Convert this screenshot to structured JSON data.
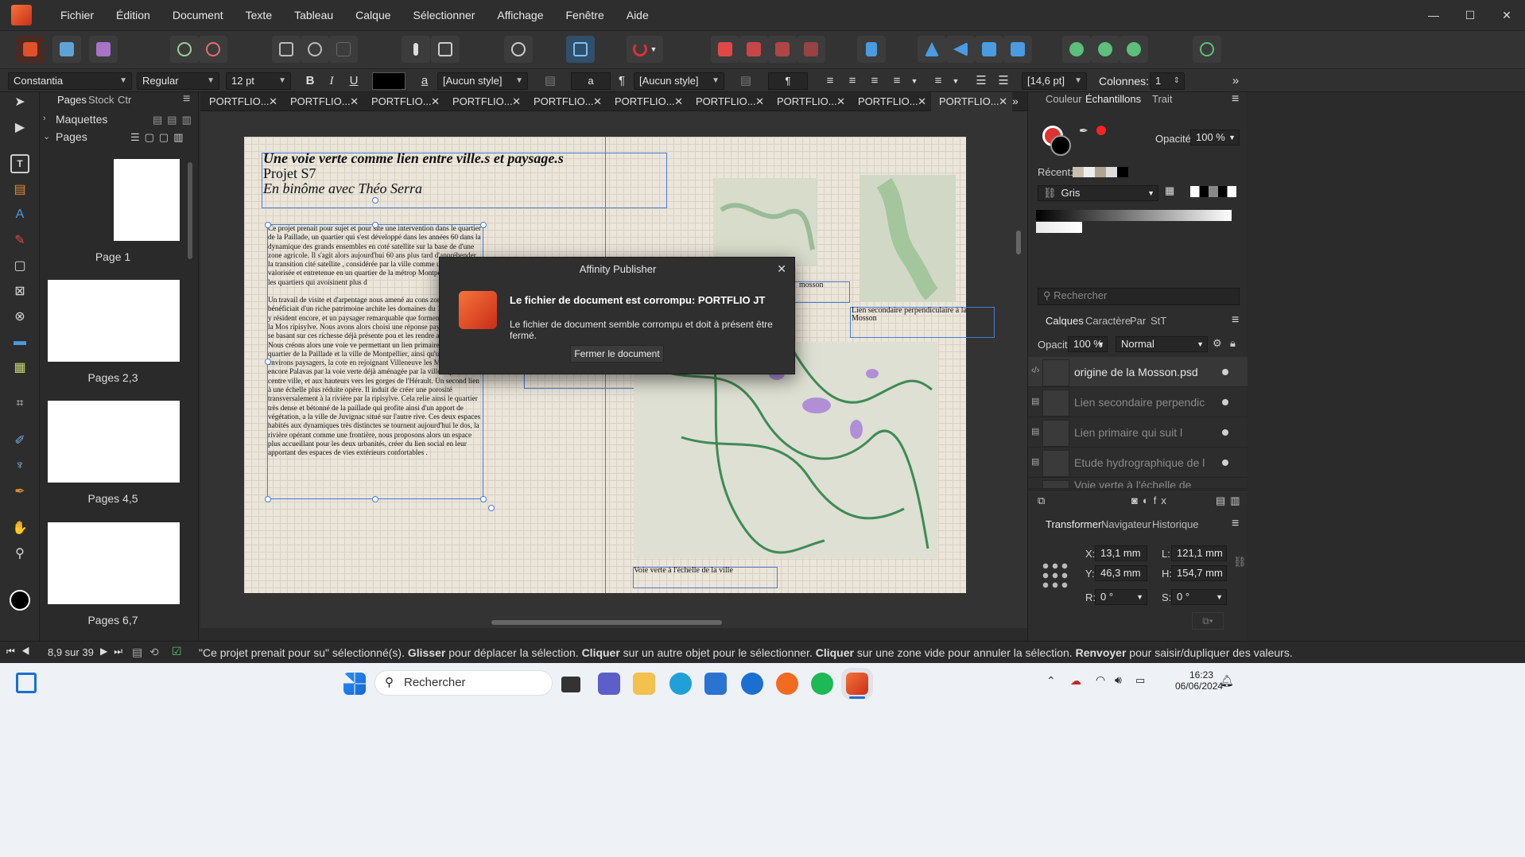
{
  "app": {
    "title": "Affinity Publisher",
    "accent": "#e0502a",
    "selection": "#4a7cd1"
  },
  "menu": [
    "Fichier",
    "Édition",
    "Document",
    "Texte",
    "Tableau",
    "Calque",
    "Sélectionner",
    "Affichage",
    "Fenêtre",
    "Aide"
  ],
  "window_controls": [
    "—",
    "☐",
    "✕"
  ],
  "context": {
    "font": "Constantia",
    "style": "Regular",
    "size": "12 pt",
    "bold": "B",
    "italic": "I",
    "underline": "U",
    "char_a": "a",
    "char_style": "[Aucun style]",
    "char_a2": "a",
    "pilcrow": "¶",
    "para_style": "[Aucun style]",
    "pilcrow2": "¶",
    "leading": "[14,6 pt]",
    "columns_label": "Colonnes:",
    "columns_value": "1",
    "more": "»"
  },
  "pages_panel": {
    "tabs": [
      "Pages",
      "Stock",
      "Ctr"
    ],
    "sections": {
      "masters": "Maquettes",
      "pages": "Pages"
    },
    "thumbs": [
      {
        "label": "Page 1"
      },
      {
        "label": "Pages 2,3"
      },
      {
        "label": "Pages 4,5"
      },
      {
        "label": "Pages 6,7"
      }
    ]
  },
  "doc_tabs": [
    "PORTFLIO...",
    "PORTFLIO...",
    "PORTFLIO...",
    "PORTFLIO...",
    "PORTFLIO...",
    "PORTFLIO...",
    "PORTFLIO...",
    "PORTFLIO...",
    "PORTFLIO...",
    "PORTFLIO..."
  ],
  "tab_close": "✕",
  "page": {
    "title_line1": "Une voie verte comme lien entre ville.s et paysage.s",
    "title_line2": "Projet S7",
    "title_line3": "En binôme avec Théo Serra",
    "body_p1": "Ce projet prenait pour sujet et pour site une intervention dans le quartier de la Paillade, un quartier qui s'est développé dans les années 60 dans la dynamique des grands ensembles en coté satellite sur la base de d'une zone agricole. Il s'agit alors aujourd'hui 60 ans plus tard d'appréhender la transition cité satellite , considérée par la ville comme un cité dor peu valorisée et entretenue en un quartier de la métrop Montpellier qui avec les quartiers qui avoisinent plus d",
    "body_p2": "Un travail de visite et d'arpentage nous amené au cons zone urbaine bénéficiait d'un riche patrimoine archite les domaines du 18e siècle qui y résident encore, et un paysager remarquable que forment la rivière de la Mos ripisylve. Nous avons alors choisi une réponse paysage rural, en se basant sur ces richesse déjà présente pou et les rendre accessibles. Nous créons alors une voie ve permettant un lien primaire entre le quartier de la Paillade et la ville de Montpellier, ainsi qu'un lien a ses environs paysagers, la cote en rejoignant Villeneuve les Maguelone ou encore Palavas par la voie verte déjà aménagée par la ville depuis le centre ville, et aux hauteurs vers les gorges de l'Hérault. Un second lien à une échelle plus réduite opère. Il induit de créer une porosité transversalement à la rivière par la ripisylve. Cela relie ainsi le quartier très dense et bétonné de la paillade qui profite ainsi d'un apport de végétation, a la ville de Juvignac situé sur l'autre rive. Ces deux espaces habités aux dynamiques très distinctes se tournent aujourd'hui le dos, la rivière opérant comme une frontière, nous proposons alors un espace plus accueillant pour les deux urbanités, créer du lien social en leur apportant des espaces de vies extérieurs confortables .",
    "caption_mosson": "mosson",
    "caption_secondary": "Lien secondaire perpendiculaire à la Mosson",
    "caption_voie": "Voie verte à l'échelle de la ville"
  },
  "dialog": {
    "title": "Affinity Publisher",
    "close": "✕",
    "heading": "Le fichier de document est corrompu: PORTFLIO JT",
    "message": "Le fichier de document semble corrompu et doit à présent être fermé.",
    "button": "Fermer le document"
  },
  "right_panel": {
    "top_tabs": [
      "Couleur",
      "Échantillons",
      "Trait"
    ],
    "opacity_label": "Opacité:",
    "opacity_value": "100 %",
    "recent_label": "Récent:",
    "palette": "Gris",
    "search_placeholder": "Rechercher",
    "layer_tabs": [
      "Calques",
      "Caractère",
      "Par",
      "StT"
    ],
    "layers_opacity_label": "Opacité:",
    "layers_opacity": "100 %",
    "blend": "Normal",
    "layers": [
      {
        "name": "origine de la Mosson.psd"
      },
      {
        "name": "Lien secondaire perpendic"
      },
      {
        "name": "Lien primaire  qui suit l"
      },
      {
        "name": "Etude hydrographique de l"
      },
      {
        "name": "Voie verte à l'échelle de"
      }
    ],
    "transform_tabs": [
      "Transformer",
      "Navigateur",
      "Historique"
    ],
    "x_label": "X:",
    "x": "13,1 mm",
    "y_label": "Y:",
    "y": "46,3 mm",
    "w_label": "L:",
    "w": "121,1 mm",
    "h_label": "H:",
    "h": "154,7 mm",
    "r_label": "R:",
    "r": "0 °",
    "s_label": "S:",
    "s": "0 °"
  },
  "status": {
    "page_counter": "8,9 sur 39",
    "message_pre": "\"Ce projet prenait pour su\" sélectionné(s). ",
    "glisser": "Glisser",
    "m1": " pour déplacer la sélection. ",
    "cliquer": "Cliquer",
    "m2": " sur un autre objet pour le sélectionner. ",
    "cliquer2": "Cliquer",
    "m3": " sur une zone vide pour annuler la sélection. ",
    "renvoyer": "Renvoyer",
    "m4": " pour saisir/dupliquer des valeurs."
  },
  "taskbar": {
    "search": "Rechercher",
    "time": "16:23",
    "date": "06/06/2024"
  }
}
